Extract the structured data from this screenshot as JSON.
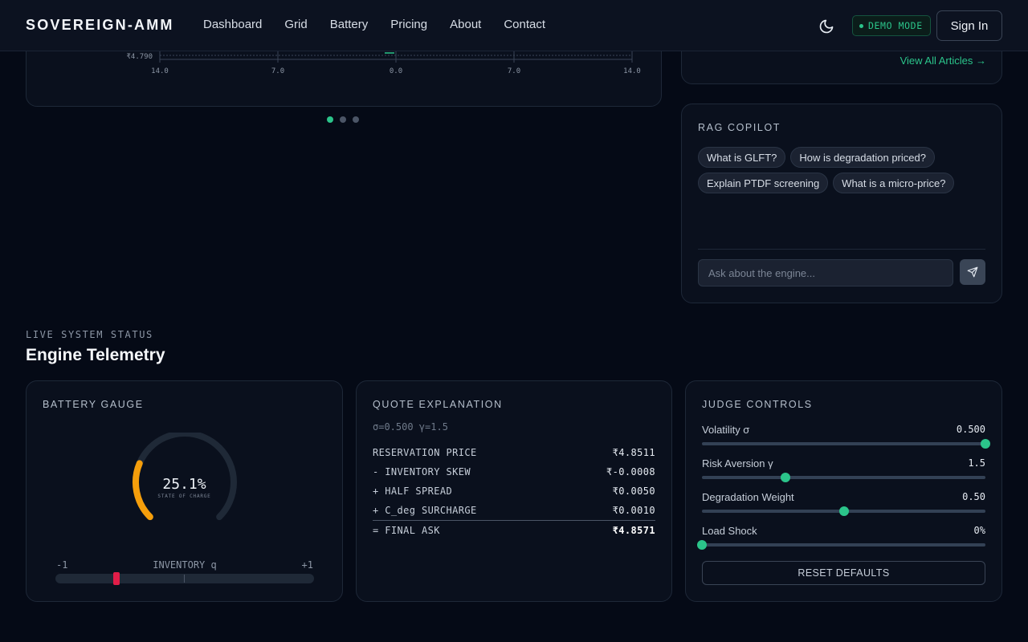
{
  "nav": {
    "brand": "SOVEREIGN-AMM",
    "links": [
      "Dashboard",
      "Grid",
      "Battery",
      "Pricing",
      "About",
      "Contact"
    ],
    "demo_badge": "DEMO MODE",
    "signin": "Sign In",
    "theme_icon": "moon-icon"
  },
  "chart_card": {
    "y_tick_label": "₹4.790",
    "x_ticks": [
      "14.0",
      "7.0",
      "0.0",
      "7.0",
      "14.0"
    ],
    "carousel_active_index": 0,
    "carousel_count": 3
  },
  "articles": {
    "view_all": "View All Articles →"
  },
  "rag": {
    "title": "RAG COPILOT",
    "suggestions": [
      "What is GLFT?",
      "How is degradation priced?",
      "Explain PTDF screening",
      "What is a micro-price?"
    ],
    "input_placeholder": "Ask about the engine...",
    "send_icon": "send-icon"
  },
  "section": {
    "kicker": "LIVE SYSTEM STATUS",
    "title": "Engine Telemetry"
  },
  "battery": {
    "title": "BATTERY GAUGE",
    "soc_value": "25.1%",
    "soc_fraction": 0.251,
    "soc_caption": "STATE OF CHARGE",
    "inv_min": "-1",
    "inv_label": "INVENTORY q",
    "inv_max": "+1",
    "inventory_q": -0.53,
    "colors": {
      "arc": "#f59e0b",
      "marker": "#e11d48"
    }
  },
  "quote": {
    "title": "QUOTE EXPLANATION",
    "params": "σ=0.500 γ=1.5",
    "rows": [
      {
        "label": "RESERVATION PRICE",
        "value": "₹4.8511"
      },
      {
        "label": "- INVENTORY SKEW",
        "value": "₹-0.0008"
      },
      {
        "label": "+ HALF SPREAD",
        "value": "₹0.0050"
      },
      {
        "label": "+ C_deg SURCHARGE",
        "value": "₹0.0010"
      }
    ],
    "final": {
      "label": "= FINAL ASK",
      "value": "₹4.8571"
    }
  },
  "judge": {
    "title": "JUDGE CONTROLS",
    "sliders": [
      {
        "label": "Volatility σ",
        "value": "0.500",
        "fraction": 1.0
      },
      {
        "label": "Risk Aversion γ",
        "value": "1.5",
        "fraction": 0.295
      },
      {
        "label": "Degradation Weight",
        "value": "0.50",
        "fraction": 0.5
      },
      {
        "label": "Load Shock",
        "value": "0%",
        "fraction": 0.0
      }
    ],
    "reset": "RESET DEFAULTS"
  },
  "accent_color": "#2bc48a"
}
